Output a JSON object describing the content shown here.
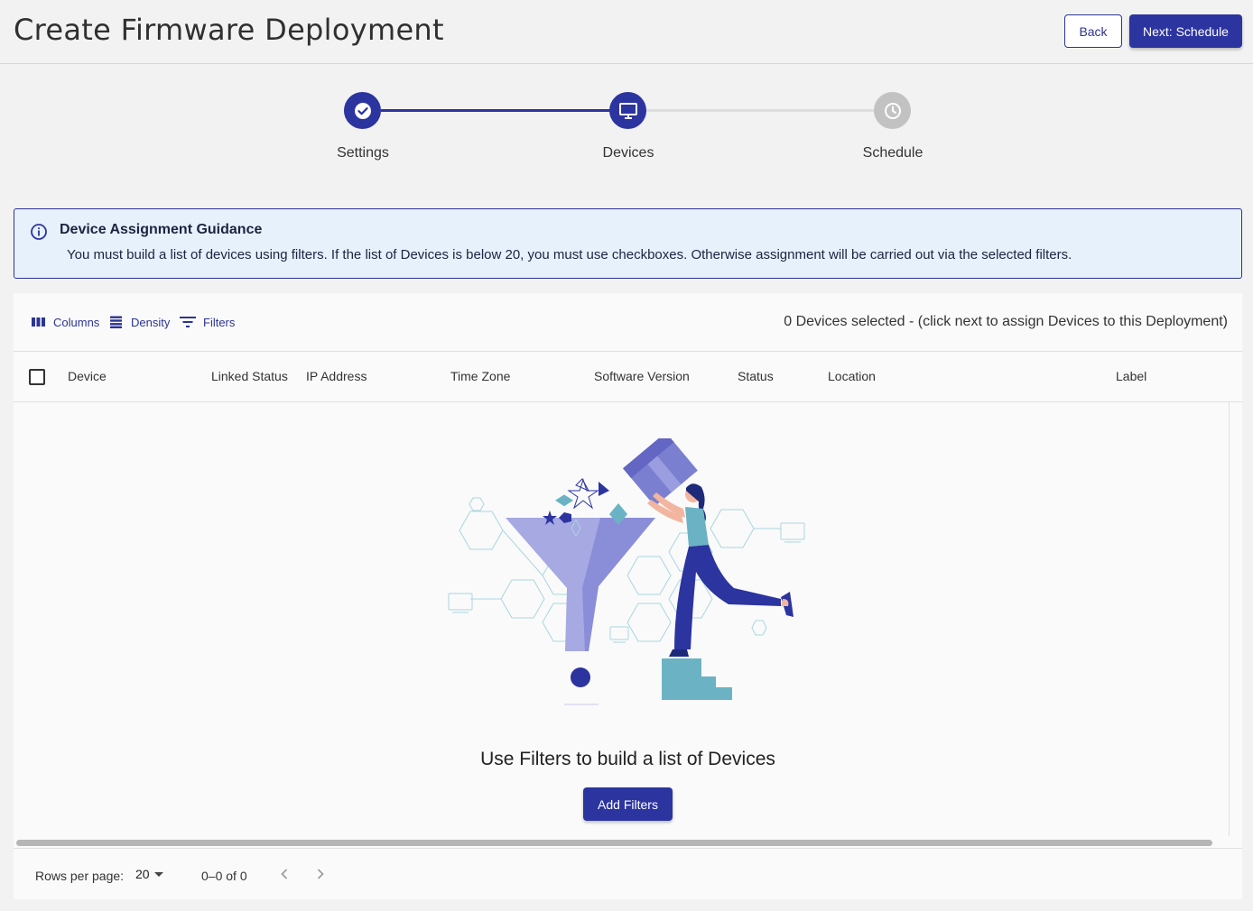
{
  "header": {
    "title": "Create Firmware Deployment",
    "back_label": "Back",
    "next_label": "Next: Schedule"
  },
  "stepper": {
    "steps": [
      {
        "label": "Settings",
        "state": "completed",
        "icon": "check-icon"
      },
      {
        "label": "Devices",
        "state": "active",
        "icon": "monitor-icon"
      },
      {
        "label": "Schedule",
        "state": "pending",
        "icon": "clock-icon"
      }
    ]
  },
  "alert": {
    "title": "Device Assignment Guidance",
    "text": "You must build a list of devices using filters. If the list of Devices is below 20, you must use checkboxes. Otherwise assignment will be carried out via the selected filters.",
    "icon": "info-icon"
  },
  "toolbar": {
    "columns_label": "Columns",
    "density_label": "Density",
    "filters_label": "Filters",
    "selected_text": "0 Devices selected - (click next to assign Devices to this Deployment)"
  },
  "table": {
    "columns": [
      "Device",
      "Linked Status",
      "IP Address",
      "Time Zone",
      "Software Version",
      "Status",
      "Location",
      "Label"
    ],
    "rows": []
  },
  "empty_state": {
    "illustration": "funnel-illustration",
    "text": "Use Filters to build a list of Devices",
    "button_label": "Add Filters"
  },
  "footer": {
    "rows_per_page_label": "Rows per page:",
    "rows_per_page_value": "20",
    "range_text": "0–0 of 0"
  },
  "colors": {
    "primary": "#2c34a0",
    "alert_bg": "#e6f1fc",
    "pending_step": "#c2c2c2",
    "illustration_purple": "#7b7fd0",
    "illustration_teal": "#6bb3c4"
  }
}
